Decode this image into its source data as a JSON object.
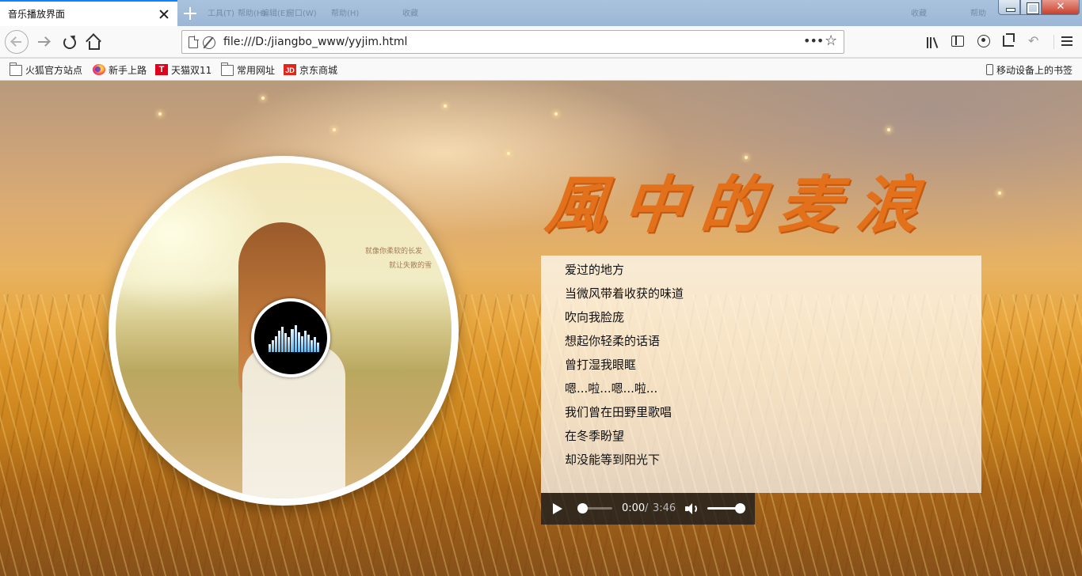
{
  "browser": {
    "tab": {
      "title": "音乐播放界面"
    },
    "ghost_tabs": [
      "工具(T)",
      "帮助(H)",
      "编辑(E)",
      "窗口(W)",
      "帮助(H)",
      "收藏",
      "帮助"
    ],
    "address_bar": {
      "url": "file:///D:/jiangbo_www/yyjim.html"
    },
    "window_controls": {
      "close_glyph": "✕"
    },
    "bookmarks": [
      {
        "label": "火狐官方站点",
        "icon": "folder-icon"
      },
      {
        "label": "新手上路",
        "icon": "firefox-icon"
      },
      {
        "label": "天猫双11",
        "icon": "tmall-icon",
        "glyph": "T"
      },
      {
        "label": "常用网址",
        "icon": "folder-icon"
      },
      {
        "label": "京东商城",
        "icon": "jd-icon",
        "glyph": "JD"
      }
    ],
    "mobile_bookmarks": {
      "label": "移动设备上的书签",
      "icon": "mobile-icon"
    }
  },
  "page": {
    "title_art": "風中的麦浪",
    "album_cover_text": [
      "就像你柔软的长发",
      "就让失散的雪"
    ],
    "lyrics": [
      "爱过的地方",
      "当微风带着收获的味道",
      "吹向我脸庞",
      "想起你轻柔的话语",
      "曾打湿我眼眶",
      "嗯...啦...嗯...啦...",
      "我们曾在田野里歌唱",
      "在冬季盼望",
      "却没能等到阳光下"
    ],
    "player": {
      "current_time": "0:00",
      "separator": "/",
      "duration": "3:46",
      "progress": 0,
      "volume": 1.0
    }
  },
  "colors": {
    "title_orange": "#e3701a",
    "tab_accent": "#0a84ff",
    "player_bg": "#1e1e1e"
  }
}
